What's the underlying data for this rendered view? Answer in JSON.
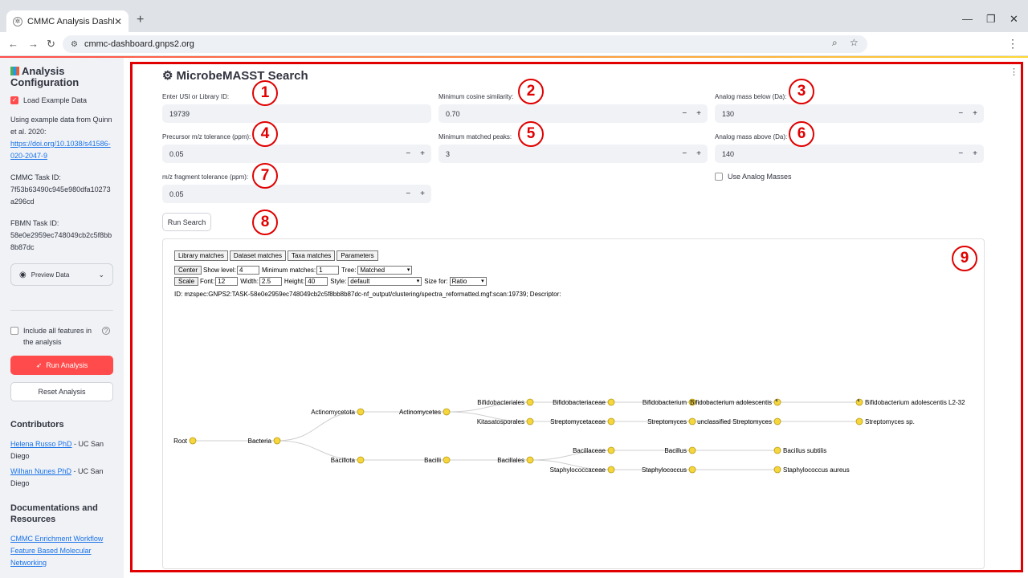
{
  "browser": {
    "tab_title": "CMMC Analysis Dashboard",
    "new_tab": "+",
    "url": "cmmc-dashboard.gnps2.org",
    "controls": {
      "minimize": "—",
      "restore": "❐",
      "close": "✕"
    }
  },
  "sidebar": {
    "title": "Analysis Configuration",
    "load_example_label": "Load Example Data",
    "example_text": "Using example data from Quinn et al. 2020:",
    "example_link": "https://doi.org/10.1038/s41586-020-2047-9",
    "cmmc_task_label": "CMMC Task ID:",
    "cmmc_task_id": "7f53b63490c945e980dfa10273a296cd",
    "fbmn_task_label": "FBMN Task ID:",
    "fbmn_task_id": "58e0e2959ec748049cb2c5f8bb8b87dc",
    "preview_label": "Preview Data",
    "include_label": "Include all features in the analysis",
    "run_label": "Run Analysis",
    "reset_label": "Reset Analysis",
    "contributors_heading": "Contributors",
    "contributors": [
      {
        "name": "Helena Russo PhD",
        "affil": " - UC San Diego"
      },
      {
        "name": "Wilhan Nunes PhD",
        "affil": " - UC San Diego"
      }
    ],
    "docs_heading": "Documentations and Resources",
    "docs": [
      "CMMC Enrichment Workflow",
      "Feature Based Molecular Networking"
    ]
  },
  "main": {
    "title": "MicrobeMASST Search",
    "fields": {
      "usi": {
        "label": "Enter USI or Library ID:",
        "value": "19739"
      },
      "cosine": {
        "label": "Minimum cosine similarity:",
        "value": "0.70"
      },
      "analog_below": {
        "label": "Analog mass below (Da):",
        "value": "130"
      },
      "precursor_tol": {
        "label": "Precursor m/z tolerance (ppm):",
        "value": "0.05"
      },
      "matched_peaks": {
        "label": "Minimum matched peaks:",
        "value": "3"
      },
      "analog_above": {
        "label": "Analog mass above (Da):",
        "value": "140"
      },
      "fragment_tol": {
        "label": "m/z fragment tolerance (ppm):",
        "value": "0.05"
      }
    },
    "use_analog_label": "Use Analog Masses",
    "run_search_label": "Run Search",
    "markers": [
      "1",
      "2",
      "3",
      "4",
      "5",
      "6",
      "7",
      "8",
      "9"
    ]
  },
  "result": {
    "tabs": [
      "Library matches",
      "Dataset matches",
      "Taxa matches",
      "Parameters"
    ],
    "center_btn": "Center",
    "show_level_label": "Show level:",
    "show_level_value": "4",
    "min_matches_label": "Minimum matches:",
    "min_matches_value": "1",
    "tree_label": "Tree:",
    "tree_value": "Matched",
    "scale_btn": "Scale",
    "font_label": "Font:",
    "font_value": "12",
    "width_label": "Width:",
    "width_value": "2.5",
    "height_label": "Height:",
    "height_value": "40",
    "style_label": "Style:",
    "style_value": "default",
    "size_for_label": "Size for:",
    "size_for_value": "Ratio",
    "id_line": "ID: mzspec:GNPS2:TASK-58e0e2959ec748049cb2c5f8bb8b87dc-nf_output/clustering/spectra_reformatted.mgf:scan:19739; Descriptor:"
  },
  "tree": {
    "node_color": "#f5d63d",
    "nodes": [
      {
        "id": "root",
        "label": "Root",
        "level": 0,
        "row": 2
      },
      {
        "id": "bacteria",
        "label": "Bacteria",
        "level": 1,
        "row": 2
      },
      {
        "id": "actinomycetota",
        "label": "Actinomycetota",
        "level": 2,
        "row": 0.5
      },
      {
        "id": "bacillota",
        "label": "Bacillota",
        "level": 2,
        "row": 3
      },
      {
        "id": "actinomycetes",
        "label": "Actinomycetes",
        "level": 3,
        "row": 0.5
      },
      {
        "id": "bacilli",
        "label": "Bacilli",
        "level": 3,
        "row": 3
      },
      {
        "id": "bifidobacteriales",
        "label": "Bifidobacteriales",
        "level": 4,
        "row": 0
      },
      {
        "id": "kitasatosporales",
        "label": "Kitasatosporales",
        "level": 4,
        "row": 1
      },
      {
        "id": "bacillales",
        "label": "Bacillales",
        "level": 4,
        "row": 3
      },
      {
        "id": "bifidobacteriaceae",
        "label": "Bifidobacteriaceae",
        "level": 5,
        "row": 0
      },
      {
        "id": "streptomycetaceae",
        "label": "Streptomycetaceae",
        "level": 5,
        "row": 1
      },
      {
        "id": "bacillaceae",
        "label": "Bacillaceae",
        "level": 5,
        "row": 2.5
      },
      {
        "id": "staphylococcaceae",
        "label": "Staphylococcaceae",
        "level": 5,
        "row": 3.5
      },
      {
        "id": "bifidobacterium",
        "label": "Bifidobacterium",
        "level": 6,
        "row": 0
      },
      {
        "id": "streptomyces",
        "label": "Streptomyces",
        "level": 6,
        "row": 1
      },
      {
        "id": "bacillus",
        "label": "Bacillus",
        "level": 6,
        "row": 2.5
      },
      {
        "id": "staphylococcus",
        "label": "Staphylococcus",
        "level": 6,
        "row": 3.5
      },
      {
        "id": "bifido_adolescentis",
        "label": "Bifidobacterium adolescentis",
        "level": 7,
        "row": 0,
        "partial": true
      },
      {
        "id": "unclassified_strep",
        "label": "unclassified Streptomyces",
        "level": 7,
        "row": 1
      },
      {
        "id": "bacillus_subtilis",
        "label": "Bacillus subtilis",
        "level": 7,
        "row": 2.5
      },
      {
        "id": "staph_aureus",
        "label": "Staphylococcus aureus",
        "level": 7,
        "row": 3.5
      },
      {
        "id": "bifido_l2_32",
        "label": "Bifidobacterium adolescentis L2-32",
        "level": 8,
        "row": 0,
        "partial": true
      },
      {
        "id": "strep_sp",
        "label": "Streptomyces sp.",
        "level": 8,
        "row": 1
      }
    ],
    "edges": [
      [
        "root",
        "bacteria"
      ],
      [
        "bacteria",
        "actinomycetota"
      ],
      [
        "bacteria",
        "bacillota"
      ],
      [
        "actinomycetota",
        "actinomycetes"
      ],
      [
        "bacillota",
        "bacilli"
      ],
      [
        "actinomycetes",
        "bifidobacteriales"
      ],
      [
        "actinomycetes",
        "kitasatosporales"
      ],
      [
        "bacilli",
        "bacillales"
      ],
      [
        "bifidobacteriales",
        "bifidobacteriaceae"
      ],
      [
        "kitasatosporales",
        "streptomycetaceae"
      ],
      [
        "bacillales",
        "bacillaceae"
      ],
      [
        "bacillales",
        "staphylococcaceae"
      ],
      [
        "bifidobacteriaceae",
        "bifidobacterium"
      ],
      [
        "streptomycetaceae",
        "streptomyces"
      ],
      [
        "bacillaceae",
        "bacillus"
      ],
      [
        "staphylococcaceae",
        "staphylococcus"
      ],
      [
        "bifidobacterium",
        "bifido_adolescentis"
      ],
      [
        "streptomyces",
        "unclassified_strep"
      ],
      [
        "bacillus",
        "bacillus_subtilis"
      ],
      [
        "staphylococcus",
        "staph_aureus"
      ],
      [
        "bifido_adolescentis",
        "bifido_l2_32"
      ],
      [
        "unclassified_strep",
        "strep_sp"
      ]
    ]
  }
}
